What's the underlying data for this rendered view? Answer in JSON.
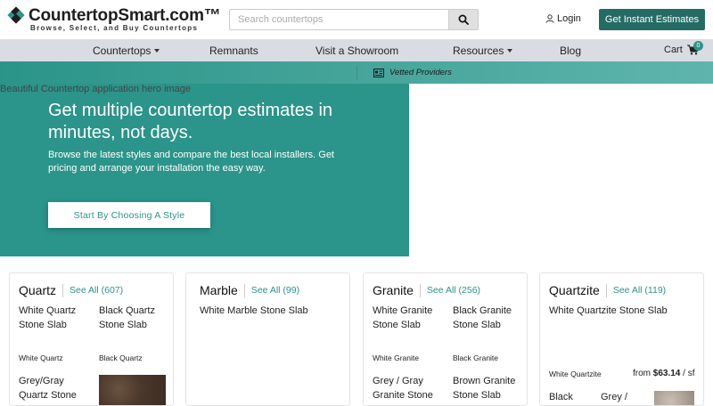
{
  "header": {
    "logo_title": "CountertopSmart.com™",
    "logo_tagline": "Browse, Select, and Buy Countertops",
    "search_placeholder": "Search countertops",
    "login_label": "Login",
    "cta_label": "Get Instant Estimates"
  },
  "nav": {
    "items": [
      "Countertops",
      "Remnants",
      "Visit a Showroom",
      "Resources",
      "Blog"
    ],
    "cart_label": "Cart",
    "cart_count": "0"
  },
  "vetted_label": "Vetted Providers",
  "hero": {
    "image_alt": "Beautiful Countertop application hero image",
    "title": "Get multiple countertop estimates in minutes, not days.",
    "subtitle": "Browse the latest styles and compare the best local installers. Get pricing and arrange your installation the easy way.",
    "button_label": "Start By Choosing A Style"
  },
  "cards": [
    {
      "title": "Quartz",
      "see_all": "See All (607)",
      "slabs": [
        "White Quartz Stone Slab",
        "Black Quartz Stone Slab",
        "Grey/Gray Quartz Stone"
      ],
      "small_labels": [
        "White Quartz",
        "Black Quartz"
      ]
    },
    {
      "title": "Marble",
      "see_all": "See All (99)",
      "slabs": [
        "White Marble Stone Slab"
      ]
    },
    {
      "title": "Granite",
      "see_all": "See All (256)",
      "slabs": [
        "White Granite Stone Slab",
        "Black Granite Stone Slab",
        "Grey / Gray Granite Stone",
        "Brown Granite Stone Slab"
      ],
      "small_labels": [
        "White Granite",
        "Black Granite"
      ]
    },
    {
      "title": "Quartzite",
      "see_all": "See All (119)",
      "slabs": [
        "White Quartzite Stone Slab",
        "Black",
        "Grey /"
      ],
      "small_labels": [
        "White Quartzite"
      ],
      "price_prefix": "from ",
      "price_value": "$63.14",
      "price_unit": " / sf"
    }
  ],
  "colors": {
    "brand_teal": "#2b948b",
    "button_dark": "#246b64",
    "nav_bg": "#d9dde3"
  }
}
